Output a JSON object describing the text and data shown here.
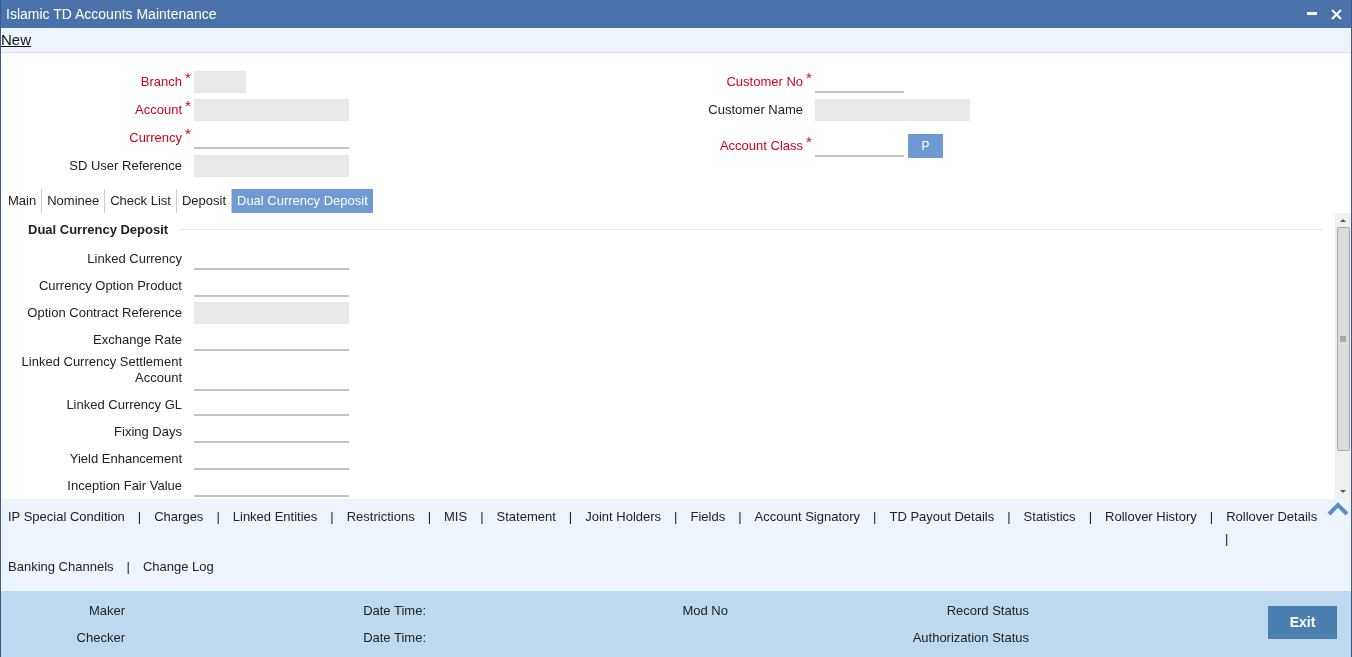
{
  "window": {
    "title": "Islamic TD Accounts Maintenance"
  },
  "toolbar": {
    "new_link": "New"
  },
  "header_fields": {
    "left": [
      {
        "label": "Branch",
        "mark": "*",
        "disabled": true,
        "kind": "short"
      },
      {
        "label": "Account",
        "mark": "*",
        "disabled": true,
        "kind": "long"
      },
      {
        "label": "Currency",
        "mark": "*",
        "disabled": false,
        "kind": "long"
      },
      {
        "label": "SD User Reference",
        "disabled": true,
        "kind": "long"
      }
    ],
    "right": [
      {
        "label": "Customer No",
        "mark": "*",
        "disabled": false,
        "kind": "short"
      },
      {
        "label": "Customer Name",
        "disabled": true,
        "kind": "long"
      },
      {
        "label": "Account Class",
        "mark": "*",
        "disabled": false,
        "kind": "short",
        "button": "P"
      }
    ]
  },
  "tabs": [
    {
      "label": "Main",
      "selected": false
    },
    {
      "label": "Nominee",
      "selected": false
    },
    {
      "label": "Check List",
      "selected": false
    },
    {
      "label": "Deposit",
      "selected": false
    },
    {
      "label": "Dual Currency Deposit",
      "selected": true
    }
  ],
  "section": {
    "title": "Dual Currency Deposit",
    "fields": [
      {
        "label": "Linked Currency",
        "disabled": false
      },
      {
        "label": "Currency Option Product",
        "disabled": false
      },
      {
        "label": "Option Contract Reference",
        "disabled": true
      },
      {
        "label": "Exchange Rate",
        "disabled": false
      },
      {
        "label": "Linked Currency Settlement Account",
        "disabled": false
      },
      {
        "label": "Linked Currency GL",
        "disabled": false
      },
      {
        "label": "Fixing Days",
        "disabled": false
      },
      {
        "label": "Yield Enhancement",
        "disabled": false
      },
      {
        "label": "Inception Fair Value",
        "disabled": false
      }
    ]
  },
  "footer_links": {
    "separator": "|",
    "rows": [
      {
        "items": [
          "IP Special Condition",
          "Charges",
          "Linked Entities",
          "Restrictions",
          "MIS",
          "Statement",
          "Joint Holders",
          "Fields",
          "Account Signatory",
          "TD Payout Details",
          "Statistics",
          "Rollover History",
          "Rollover Details"
        ],
        "trailing_separator": true
      },
      {
        "items": [
          "Banking Channels",
          "Change Log"
        ],
        "trailing_separator": false
      }
    ]
  },
  "audit": {
    "left": [
      {
        "label": "Maker",
        "date_label": "Date Time:"
      },
      {
        "label": "Checker",
        "date_label": "Date Time:"
      }
    ],
    "right": [
      "Mod No",
      "Record Status",
      "Authorization Status"
    ]
  },
  "exit_button": "Exit"
}
